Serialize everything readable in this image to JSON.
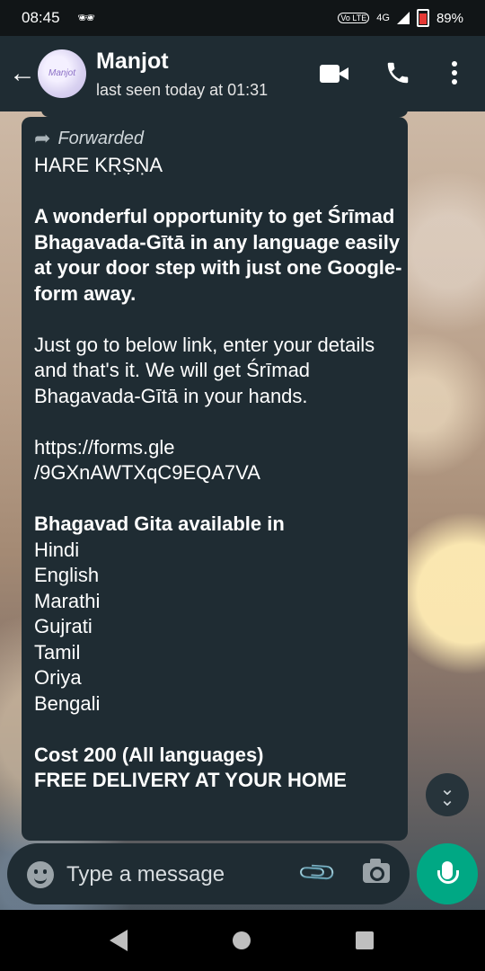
{
  "status_bar": {
    "time": "08:45",
    "network": "4G",
    "volte": "Vo LTE",
    "battery": "89%"
  },
  "header": {
    "contact_name": "Manjot",
    "last_seen": "last seen today at 01:31",
    "avatar_text": "Manjot"
  },
  "message": {
    "forwarded_label": "Forwarded",
    "lines": {
      "l1": "HARE KṚṢṆA",
      "l2": "A wonderful opportunity to get Śrīmad Bhagavada-Gītā in any language easily at your door step with just one Google-form away.",
      "l3": "Just go to below link, enter your details and that's it. We will get Śrīmad Bhagavada-Gītā in your hands.",
      "l4a": "https://forms.gle",
      "l4b": "/9GXnAWTXqC9EQA7VA",
      "l5": "Bhagavad Gita available in",
      "languages": [
        "Hindi",
        "English",
        "Marathi",
        "Gujrati",
        "Tamil",
        "Oriya",
        "Bengali"
      ],
      "l6": "Cost 200 (All languages)",
      "l7": "FREE DELIVERY AT YOUR HOME"
    }
  },
  "input_bar": {
    "placeholder": "Type a message"
  },
  "colors": {
    "header_bg": "#1f2c33",
    "bubble_bg": "#1f2c33",
    "accent": "#00a884"
  }
}
